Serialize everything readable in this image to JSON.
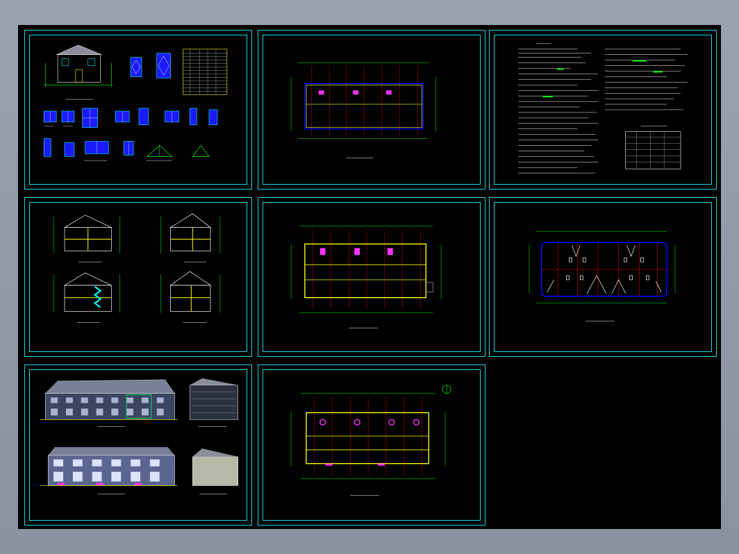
{
  "app": {
    "name": "",
    "background_color": "#000000",
    "frame_color": "#18d7e6"
  },
  "sheets": [
    {
      "id": "sheet-1-1",
      "content": "elevations-and-window-details",
      "caption": "",
      "caption2": ""
    },
    {
      "id": "sheet-1-2",
      "content": "floor-plan",
      "caption": ""
    },
    {
      "id": "sheet-1-3",
      "content": "design-notes-text",
      "caption": ""
    },
    {
      "id": "sheet-2-1",
      "content": "sections",
      "caption": "",
      "caption2": ""
    },
    {
      "id": "sheet-2-2",
      "content": "floor-plan",
      "caption": ""
    },
    {
      "id": "sheet-2-3",
      "content": "roof-plan",
      "caption": ""
    },
    {
      "id": "sheet-3-1",
      "content": "colored-elevations",
      "caption": "",
      "caption2": ""
    },
    {
      "id": "sheet-3-2",
      "content": "floor-plan",
      "caption": ""
    }
  ],
  "colors": {
    "wall": "#ffff00",
    "axis": "#ff0000",
    "dim": "#00ff00",
    "window": "#00ffff",
    "door": "#ff00ff",
    "outline": "#0000ff",
    "text": "#ffffff"
  },
  "icons": {
    "north_arrow": "north-arrow-icon"
  }
}
